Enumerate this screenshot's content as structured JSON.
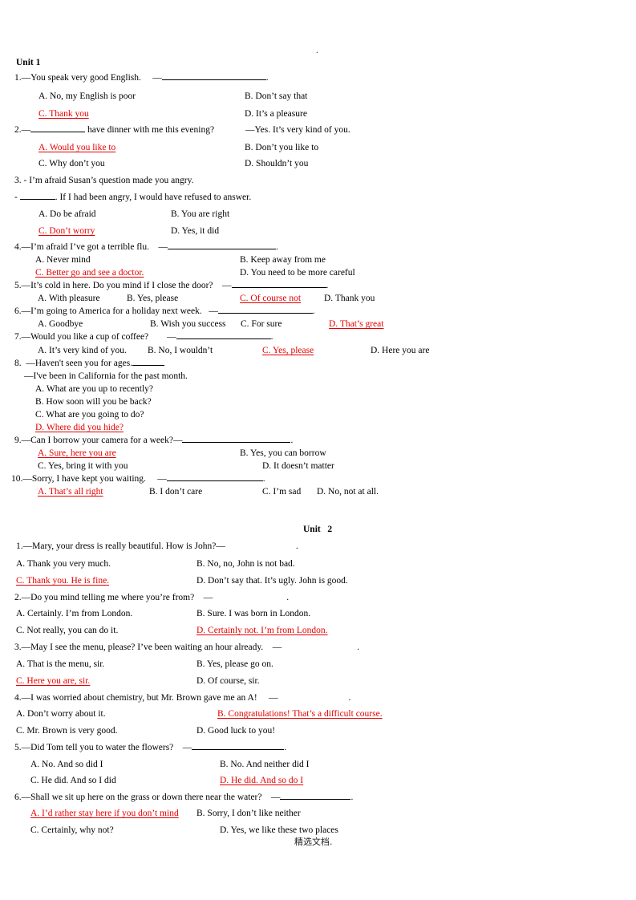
{
  "document": {
    "top_mark": ".",
    "footer": "精选文档."
  },
  "units": [
    {
      "heading": "Unit 1",
      "questions": [
        {
          "number": "1.",
          "stem": "1.—You speak very good English.     —",
          "stem_blank": true,
          "stem_tail": ".",
          "options": [
            {
              "label": "A. No, my English is poor",
              "correct": false
            },
            {
              "label": "B. Don’t say that",
              "correct": false
            },
            {
              "label": "C. Thank you",
              "correct": true
            },
            {
              "label": "D. It’s a pleasure",
              "correct": false
            }
          ]
        },
        {
          "number": "2.",
          "stem": "2.—",
          "stem_mid": " have dinner with me this evening?",
          "stem_reply": "—Yes. It’s very kind of you.",
          "options": [
            {
              "label": "A. Would you like to",
              "correct": true
            },
            {
              "label": "B. Don’t you like to",
              "correct": false
            },
            {
              "label": "C. Why don’t you",
              "correct": false
            },
            {
              "label": "D. Shouldn’t you",
              "correct": false
            }
          ]
        },
        {
          "number": "3.",
          "stem": "3. - I’m afraid Susan’s question made you angry.",
          "stem2_lead": "- ",
          "stem2_tail": ". If I had been angry, I would have refused to answer.",
          "options": [
            {
              "label": "A. Do be afraid",
              "correct": false
            },
            {
              "label": "B. You are right",
              "correct": false
            },
            {
              "label": "C. Don’t worry",
              "correct": true
            },
            {
              "label": "D. Yes, it did",
              "correct": false
            }
          ]
        },
        {
          "number": "4.",
          "stem": "4.—I’m afraid I’ve got a terrible flu.    —",
          "stem_tail": ".",
          "options": [
            {
              "label": "A. Never mind",
              "correct": false
            },
            {
              "label": "B. Keep away from me",
              "correct": false
            },
            {
              "label": "C. Better go and see a doctor.",
              "correct": true
            },
            {
              "label": "D. You need to be more careful",
              "correct": false
            }
          ]
        },
        {
          "number": "5.",
          "stem": "5.—It’s cold in here. Do you mind if I close the door?    —",
          "stem_tail": ".",
          "options": [
            {
              "label": "A. With pleasure",
              "correct": false
            },
            {
              "label": "B. Yes, please",
              "correct": false
            },
            {
              "label": "C. Of course not",
              "correct": true
            },
            {
              "label": "D. Thank you",
              "correct": false
            }
          ]
        },
        {
          "number": "6.",
          "stem": "6.—I’m going to America for a holiday next week.   —",
          "stem_tail": ".",
          "options": [
            {
              "label": "A. Goodbye",
              "correct": false
            },
            {
              "label": "B. Wish you success",
              "correct": false
            },
            {
              "label": "C. For sure",
              "correct": false
            },
            {
              "label": "D. That’s great",
              "correct": true
            }
          ]
        },
        {
          "number": "7.",
          "stem": "7.—Would you like a cup of coffee?        —",
          "stem_tail": ".",
          "options": [
            {
              "label": "A. It’s very kind of you.",
              "correct": false
            },
            {
              "label": "B. No, I wouldn’t",
              "correct": false
            },
            {
              "label": "C. Yes, please",
              "correct": true
            },
            {
              "label": "D. Here you are",
              "correct": false
            }
          ]
        },
        {
          "number": "8.",
          "stem": "8.  —Haven't seen you for ages.",
          "stem2": "—I've been in California for the past month.",
          "options": [
            {
              "label": "A. What are you up to recently?",
              "correct": false
            },
            {
              "label": "B. How soon will you be back?",
              "correct": false
            },
            {
              "label": "C. What are you going to do?",
              "correct": false
            },
            {
              "label": "D. Where did you hide?",
              "correct": true
            }
          ]
        },
        {
          "number": "9.",
          "stem": "9.—Can I borrow your camera for a week?—",
          "stem_tail": ".",
          "options": [
            {
              "label": "A. Sure, here you are",
              "correct": true
            },
            {
              "label": "B. Yes, you can borrow",
              "correct": false
            },
            {
              "label": "C. Yes, bring it with you",
              "correct": false
            },
            {
              "label": "D. It doesn’t matter",
              "correct": false
            }
          ]
        },
        {
          "number": "10.",
          "stem": "10.—Sorry, I have kept you waiting.     —",
          "stem_tail": ".",
          "options": [
            {
              "label": "A. That’s all right",
              "correct": true
            },
            {
              "label": "B. I don’t care",
              "correct": false
            },
            {
              "label": "C. I’m sad",
              "correct": false
            },
            {
              "label": "D. No, not at all.",
              "correct": false
            }
          ]
        }
      ]
    },
    {
      "heading": "Unit   2",
      "questions": [
        {
          "number": "1.",
          "stem": "1.—Mary, your dress is really beautiful. How is John?—",
          "stem_tail": ".",
          "options": [
            {
              "label": "A. Thank you very much.",
              "correct": false
            },
            {
              "label": "B. No, no, John is not bad.",
              "correct": false
            },
            {
              "label": "C. Thank you. He is fine.",
              "correct": true
            },
            {
              "label": "D. Don’t say that. It’s ugly. John is good.",
              "correct": false
            }
          ]
        },
        {
          "number": "2.",
          "stem": "2.—Do you mind telling me where you’re from?    —",
          "stem_tail": ".",
          "options": [
            {
              "label": "A. Certainly. I’m from London.",
              "correct": false
            },
            {
              "label": "B. Sure. I was born in London.",
              "correct": false
            },
            {
              "label": "C. Not really, you can do it.",
              "correct": false
            },
            {
              "label": "D. Certainly not. I’m from London.",
              "correct": true
            }
          ]
        },
        {
          "number": "3.",
          "stem": "3.—May I see the menu, please? I’ve been waiting an hour already.    —",
          "stem_tail": ".",
          "options": [
            {
              "label": "A. That is the menu, sir.",
              "correct": false
            },
            {
              "label": "B. Yes, please go on.",
              "correct": false
            },
            {
              "label": "C. Here you are, sir.",
              "correct": true
            },
            {
              "label": "D. Of course, sir.",
              "correct": false
            }
          ]
        },
        {
          "number": "4.",
          "stem": "4.—I was worried about chemistry, but Mr. Brown gave me an A!     —",
          "stem_tail": ".",
          "options": [
            {
              "label": "A. Don’t worry about it.",
              "correct": false
            },
            {
              "label": "B. Congratulations! That’s a difficult course.",
              "correct": true
            },
            {
              "label": "C. Mr. Brown is very good.",
              "correct": false
            },
            {
              "label": "D. Good luck to you!",
              "correct": false
            }
          ]
        },
        {
          "number": "5.",
          "stem": "5.—Did Tom tell you to water the flowers?    —",
          "stem_tail": ".",
          "options": [
            {
              "label": "A. No. And so did I",
              "correct": false
            },
            {
              "label": "B. No. And neither did I",
              "correct": false
            },
            {
              "label": "C. He did. And so I did",
              "correct": false
            },
            {
              "label": "D. He did. And so do I",
              "correct": true
            }
          ]
        },
        {
          "number": "6.",
          "stem": "6.—Shall we sit up here on the grass or down there near the water?    —",
          "stem_tail": ".",
          "options": [
            {
              "label": "A. I’d rather stay here if you don’t mind",
              "correct": true
            },
            {
              "label": "B. Sorry, I don’t like neither",
              "correct": false
            },
            {
              "label": "C. Certainly, why not?",
              "correct": false
            },
            {
              "label": "D. Yes, we like these two places",
              "correct": false
            }
          ]
        }
      ]
    }
  ]
}
